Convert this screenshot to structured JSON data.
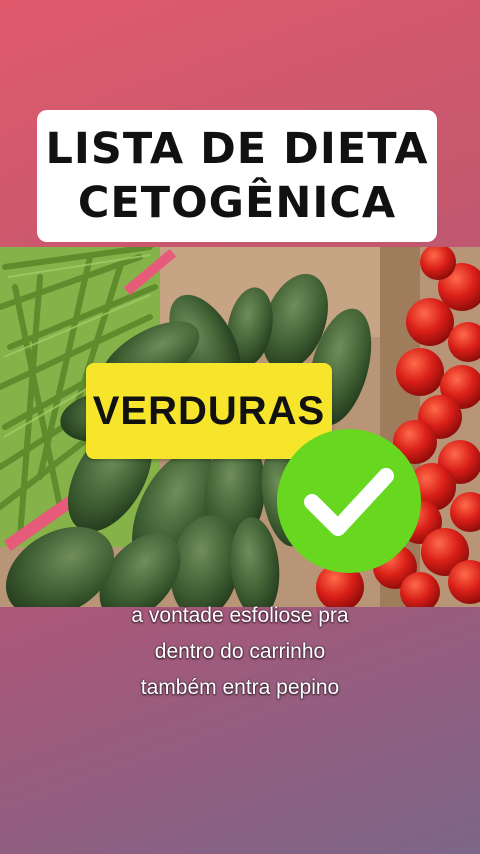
{
  "title": {
    "line1": "LISTA DE DIETA",
    "line2": "CETOGÊNICA"
  },
  "badge": {
    "label": "VERDURAS"
  },
  "check_icon": {
    "name": "check-circle-icon",
    "color": "#67d81f"
  },
  "caption": {
    "line1": "a vontade esfoliose pra",
    "line2": "dentro do carrinho",
    "line3": "também entra pepino"
  },
  "colors": {
    "badge": "#f6e52a",
    "background_top": "#e05a6c",
    "background_bottom": "#7c6688"
  }
}
